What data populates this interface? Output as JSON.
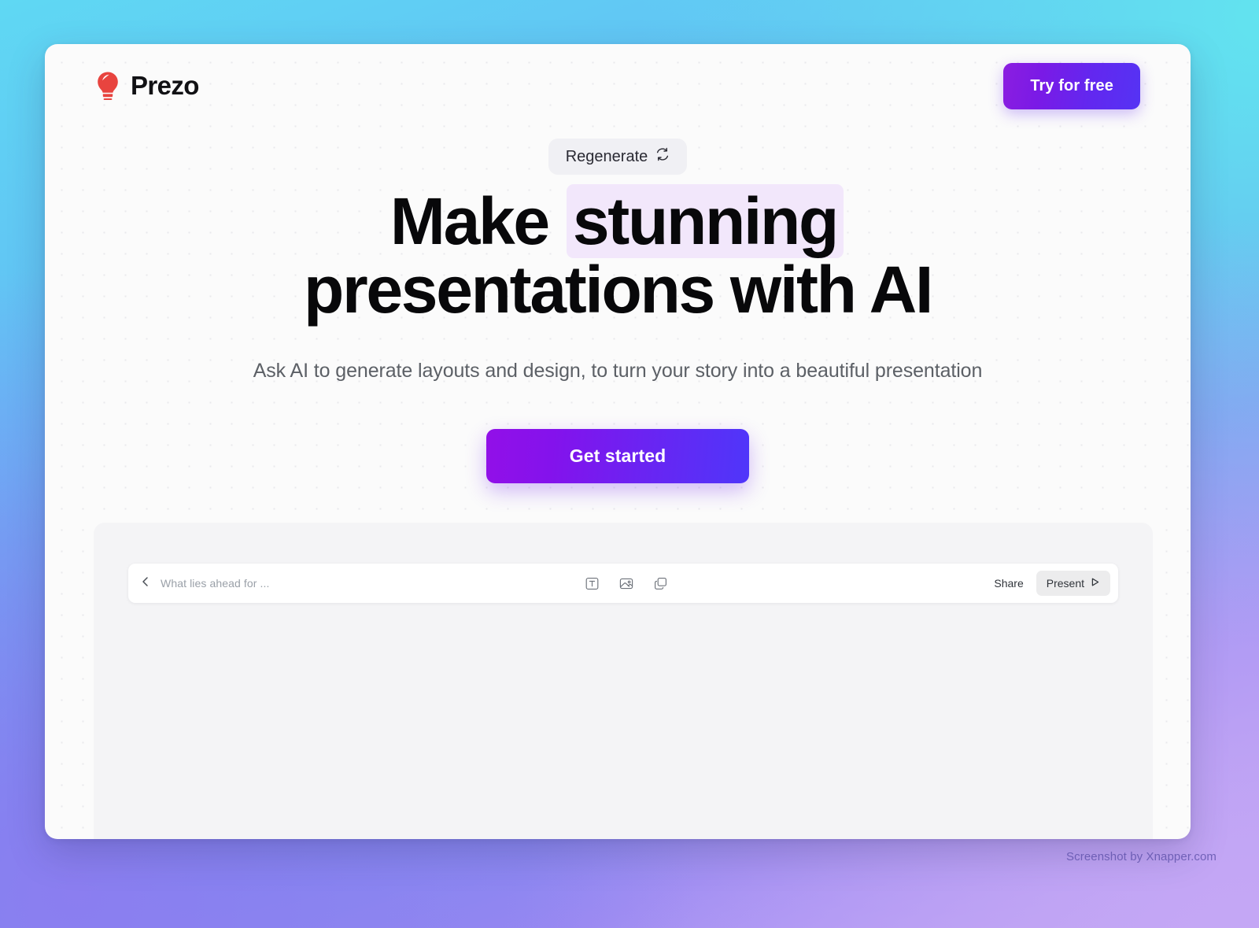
{
  "header": {
    "brand_name": "Prezo",
    "brand_icon": "lightbulb-icon",
    "brand_icon_color": "#e8443f",
    "cta_label": "Try for free",
    "cta_gradient_from": "#8b1ee0",
    "cta_gradient_to": "#5533f4"
  },
  "hero": {
    "regenerate_label": "Regenerate",
    "regenerate_icon": "refresh-icon",
    "headline_line1_prefix": "Make",
    "headline_highlight": "stunning",
    "headline_line2": "presentations with AI",
    "headline_highlight_bg": "#f2e7fb",
    "subtitle": "Ask AI to generate layouts and design, to turn your story into a beautiful presentation",
    "primary_cta_label": "Get started",
    "primary_cta_gradient_from": "#9210e8",
    "primary_cta_gradient_to": "#4f36fa"
  },
  "editor": {
    "back_icon": "chevron-left-icon",
    "doc_title": "What lies ahead for ...",
    "tools": [
      {
        "name": "text-box-icon",
        "label": "Text"
      },
      {
        "name": "image-icon",
        "label": "Image"
      },
      {
        "name": "shape-icon",
        "label": "Shape"
      }
    ],
    "share_label": "Share",
    "present_label": "Present",
    "present_icon": "play-icon"
  },
  "watermark": {
    "text": "Screenshot by Xnapper.com"
  },
  "background": {
    "top_right": "#62e3ef",
    "bottom_left": "#8b7ef0",
    "bottom_right": "#c4a7f5"
  }
}
